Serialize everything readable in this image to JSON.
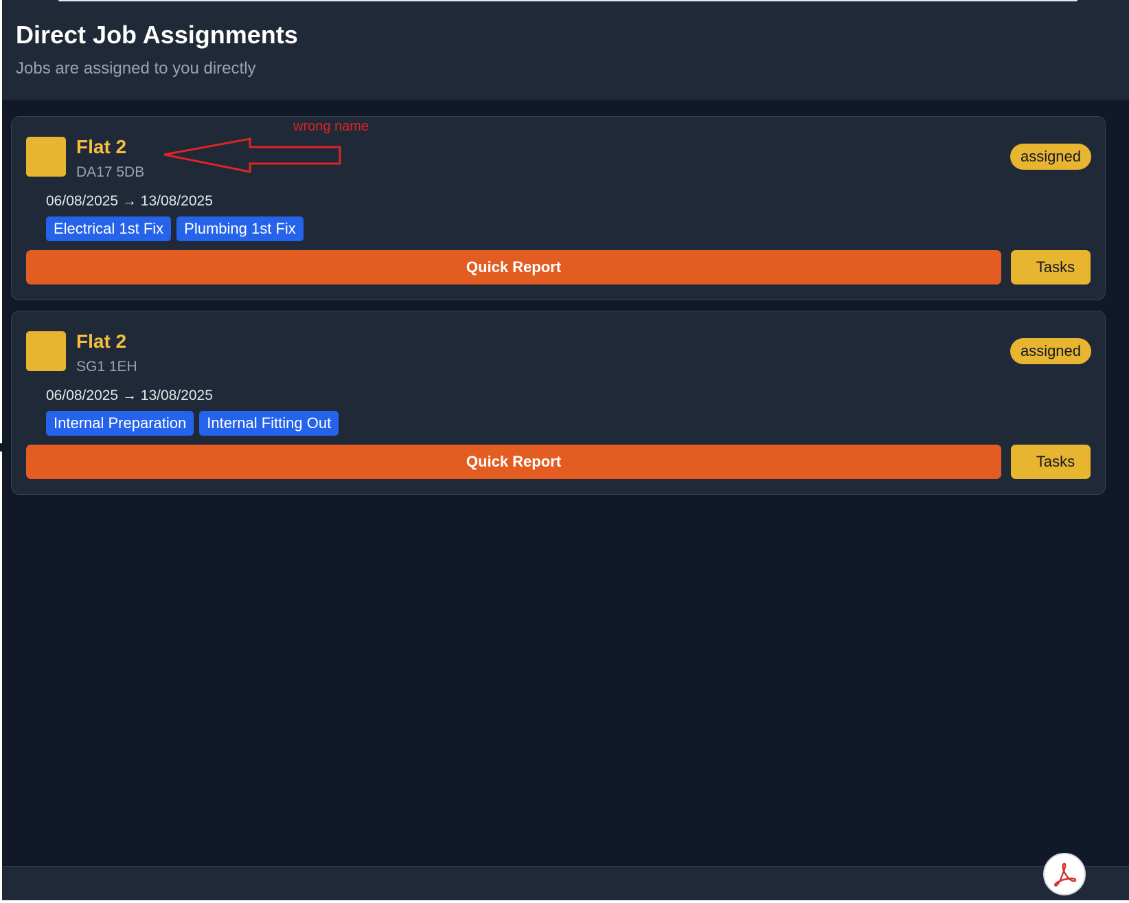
{
  "header": {
    "title": "Direct Job Assignments",
    "subtitle": "Jobs are assigned to you directly"
  },
  "jobs": [
    {
      "title": "Flat 2",
      "postcode": "DA17 5DB",
      "dates": "06/08/2025 → 13/08/2025",
      "status": "assigned",
      "tags": [
        "Electrical 1st Fix",
        "Plumbing 1st Fix"
      ],
      "quick_report_label": "Quick Report",
      "tasks_label": "Tasks"
    },
    {
      "title": "Flat 2",
      "postcode": "SG1 1EH",
      "dates": "06/08/2025 → 13/08/2025",
      "status": "assigned",
      "tags": [
        "Internal Preparation",
        "Internal Fitting Out"
      ],
      "quick_report_label": "Quick Report",
      "tasks_label": "Tasks"
    }
  ],
  "annotation": {
    "text": "wrong name",
    "color": "#e02424"
  },
  "fab": {
    "icon": "pdf-icon"
  },
  "colors": {
    "background": "#111827",
    "panel": "#1f2937",
    "accent_yellow": "#e8b530",
    "title_yellow": "#f4c040",
    "tag_blue": "#2563eb",
    "report_orange": "#e35d22"
  }
}
